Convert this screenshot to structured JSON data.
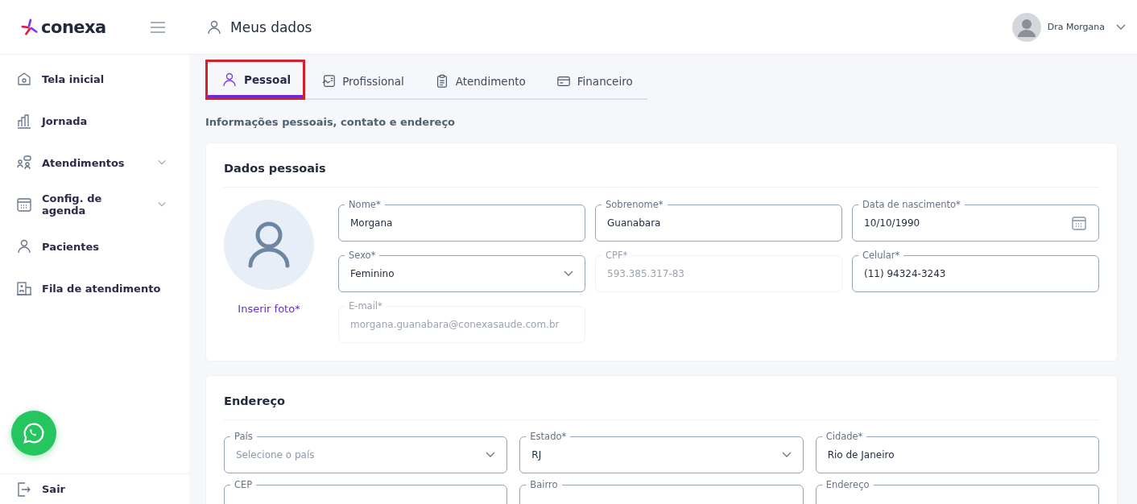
{
  "header": {
    "logo": "conexa",
    "title": "Meus dados",
    "user": "Dra Morgana"
  },
  "sidebar": {
    "items": [
      {
        "label": "Tela inicial",
        "expandable": false
      },
      {
        "label": "Jornada",
        "expandable": false
      },
      {
        "label": "Atendimentos",
        "expandable": true
      },
      {
        "label": "Config. de agenda",
        "expandable": true
      },
      {
        "label": "Pacientes",
        "expandable": false
      },
      {
        "label": "Fila de atendimento",
        "expandable": false
      }
    ],
    "logout": "Sair"
  },
  "tabs": [
    {
      "label": "Pessoal",
      "selected": true,
      "highlighted": true
    },
    {
      "label": "Profissional",
      "selected": false,
      "highlighted": false
    },
    {
      "label": "Atendimento",
      "selected": false,
      "highlighted": false
    },
    {
      "label": "Financeiro",
      "selected": false,
      "highlighted": false
    }
  ],
  "subtitle": "Informações pessoais, contato e endereço",
  "personal": {
    "title": "Dados pessoais",
    "photo_link": "Inserir foto*",
    "fields": [
      {
        "label": "Nome*",
        "value": "Morgana",
        "kind": "text",
        "disabled": false
      },
      {
        "label": "Sobrenome*",
        "value": "Guanabara",
        "kind": "text",
        "disabled": false
      },
      {
        "label": "Data de nascimento*",
        "value": "10/10/1990",
        "kind": "date",
        "disabled": false
      },
      {
        "label": "Sexo*",
        "value": "Feminino",
        "kind": "select",
        "disabled": false
      },
      {
        "label": "CPF*",
        "value": "593.385.317-83",
        "kind": "text",
        "disabled": true
      },
      {
        "label": "Celular*",
        "value": "(11) 94324-3243",
        "kind": "text",
        "disabled": false
      },
      {
        "label": "E-mail*",
        "value": "morgana.guanabara@conexasaude.com.br",
        "kind": "text",
        "disabled": true
      }
    ]
  },
  "address": {
    "title": "Endereço",
    "fields": [
      {
        "label": "País",
        "placeholder": "Selecione o país",
        "kind": "select",
        "disabled": false
      },
      {
        "label": "Estado*",
        "value": "RJ",
        "kind": "select",
        "disabled": false
      },
      {
        "label": "Cidade*",
        "value": "Rio de Janeiro",
        "kind": "text",
        "disabled": false
      },
      {
        "label": "CEP",
        "kind": "text",
        "disabled": false
      },
      {
        "label": "Bairro",
        "kind": "text",
        "disabled": false
      },
      {
        "label": "Endereço",
        "kind": "text",
        "disabled": false
      }
    ]
  }
}
